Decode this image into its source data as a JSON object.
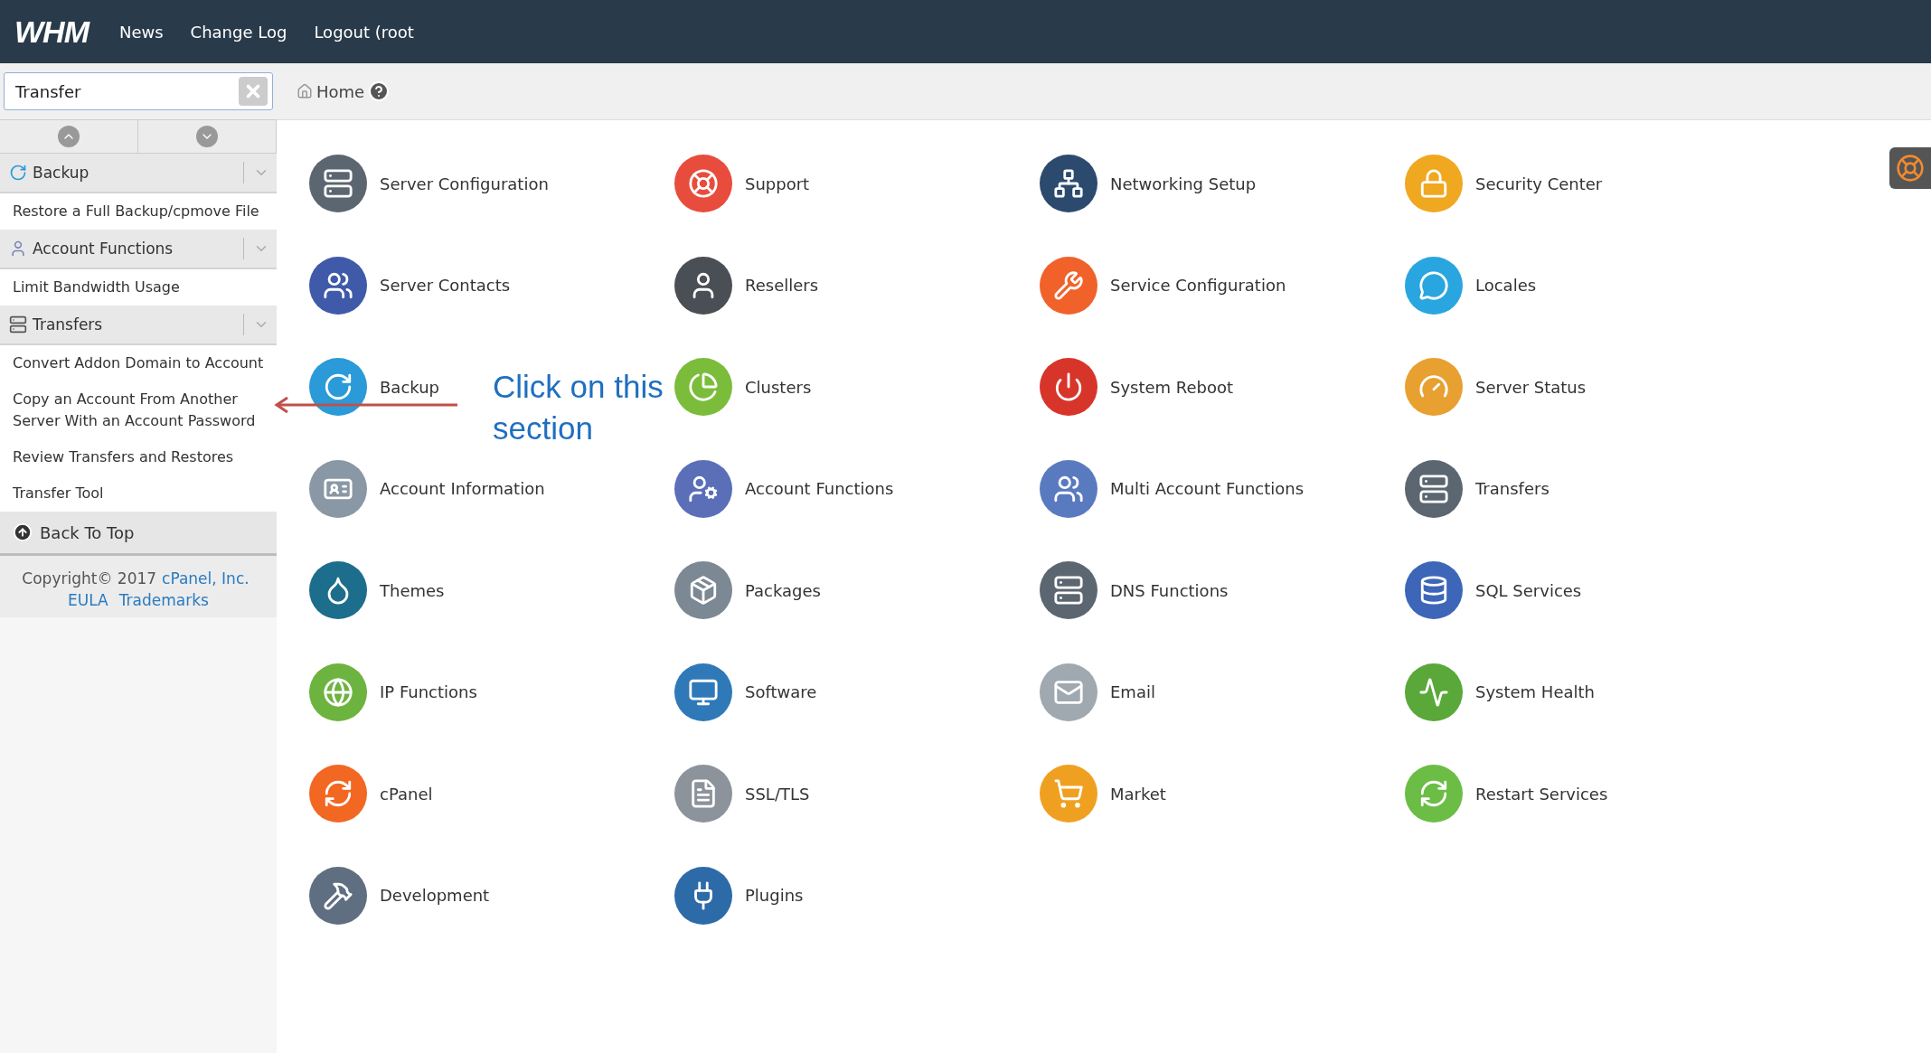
{
  "topbar": {
    "logo": "WHM",
    "links": [
      "News",
      "Change Log",
      "Logout (root"
    ]
  },
  "sidebar": {
    "search": {
      "value": "Transfer"
    },
    "sections": [
      {
        "title": "Backup",
        "kind": "backup",
        "items": [
          "Restore a Full Backup/cpmove File"
        ]
      },
      {
        "title": "Account Functions",
        "kind": "account",
        "items": [
          "Limit Bandwidth Usage"
        ]
      },
      {
        "title": "Transfers",
        "kind": "transfers",
        "items": [
          "Convert Addon Domain to Account",
          "Copy an Account From Another Server With an Account Password",
          "Review Transfers and Restores",
          "Transfer Tool"
        ]
      }
    ],
    "back_to_top": "Back To Top",
    "footer": {
      "copyright": "Copyright© 2017",
      "company": "cPanel, Inc.",
      "links": [
        "EULA",
        "Trademarks"
      ]
    }
  },
  "breadcrumb": "Home",
  "tiles": [
    "Server Configuration",
    "Support",
    "Networking Setup",
    "Security Center",
    "Server Contacts",
    "Resellers",
    "Service Configuration",
    "Locales",
    "Backup",
    "Clusters",
    "System Reboot",
    "Server Status",
    "Account Information",
    "Account Functions",
    "Multi Account Functions",
    "Transfers",
    "Themes",
    "Packages",
    "DNS Functions",
    "SQL Services",
    "IP Functions",
    "Software",
    "Email",
    "System Health",
    "cPanel",
    "SSL/TLS",
    "Market",
    "Restart Services",
    "Development",
    "Plugins"
  ],
  "annotation": "Click on this section"
}
